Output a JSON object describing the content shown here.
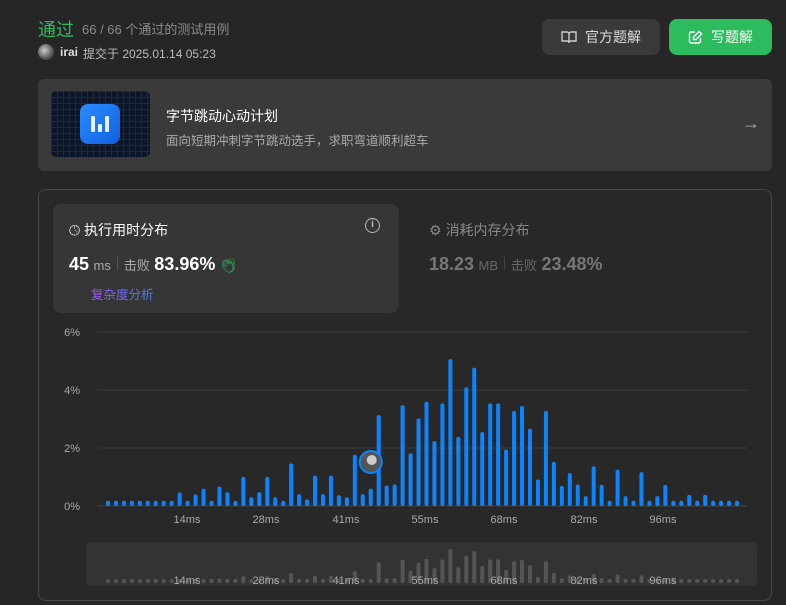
{
  "header": {
    "status": "通过",
    "cases": "66 / 66 个通过的测试用例",
    "user": "irai",
    "submitted": "提交于 2025.01.14 05:23"
  },
  "buttons": {
    "official": "官方题解",
    "write": "写题解"
  },
  "banner": {
    "title": "字节跳动心动计划",
    "subtitle": "面向短期冲刺字节跳动选手，求职弯道顺利超车"
  },
  "runtime": {
    "title": "执行用时分布",
    "value": "45",
    "unit": "ms",
    "beats_label": "击败",
    "beats": "83.96%",
    "complexity_link": "复杂度分析"
  },
  "memory": {
    "title": "消耗内存分布",
    "value": "18.23",
    "unit": "MB",
    "beats_label": "击败",
    "beats": "23.48%"
  },
  "colors": {
    "accent": "#2cbb5d",
    "bar": "#0a84ff"
  },
  "chart_data": {
    "type": "bar",
    "ylabel_ticks": [
      "0%",
      "2%",
      "4%",
      "6%"
    ],
    "ylim": [
      0,
      6
    ],
    "xticks": [
      "14ms",
      "28ms",
      "41ms",
      "55ms",
      "68ms",
      "82ms",
      "96ms"
    ],
    "user_bar_index": 33,
    "values": [
      0.18,
      0.18,
      0.18,
      0.18,
      0.18,
      0.18,
      0.18,
      0.18,
      0.18,
      0.47,
      0.18,
      0.4,
      0.6,
      0.18,
      0.67,
      0.48,
      0.18,
      1.01,
      0.3,
      0.48,
      1.01,
      0.3,
      0.18,
      1.47,
      0.41,
      0.23,
      1.05,
      0.41,
      1.05,
      0.37,
      0.3,
      1.77,
      0.41,
      0.6,
      3.14,
      0.71,
      0.75,
      3.48,
      1.82,
      3.02,
      3.6,
      2.24,
      3.54,
      5.07,
      2.39,
      4.09,
      4.77,
      2.55,
      3.54,
      3.54,
      1.95,
      3.28,
      3.45,
      2.67,
      0.92,
      3.28,
      1.52,
      0.69,
      1.14,
      0.74,
      0.34,
      1.37,
      0.73,
      0.18,
      1.25,
      0.34,
      0.18,
      1.17,
      0.18,
      0.34,
      0.73,
      0.18,
      0.18,
      0.39,
      0.18,
      0.39,
      0.18,
      0.18,
      0.18,
      0.18
    ]
  }
}
